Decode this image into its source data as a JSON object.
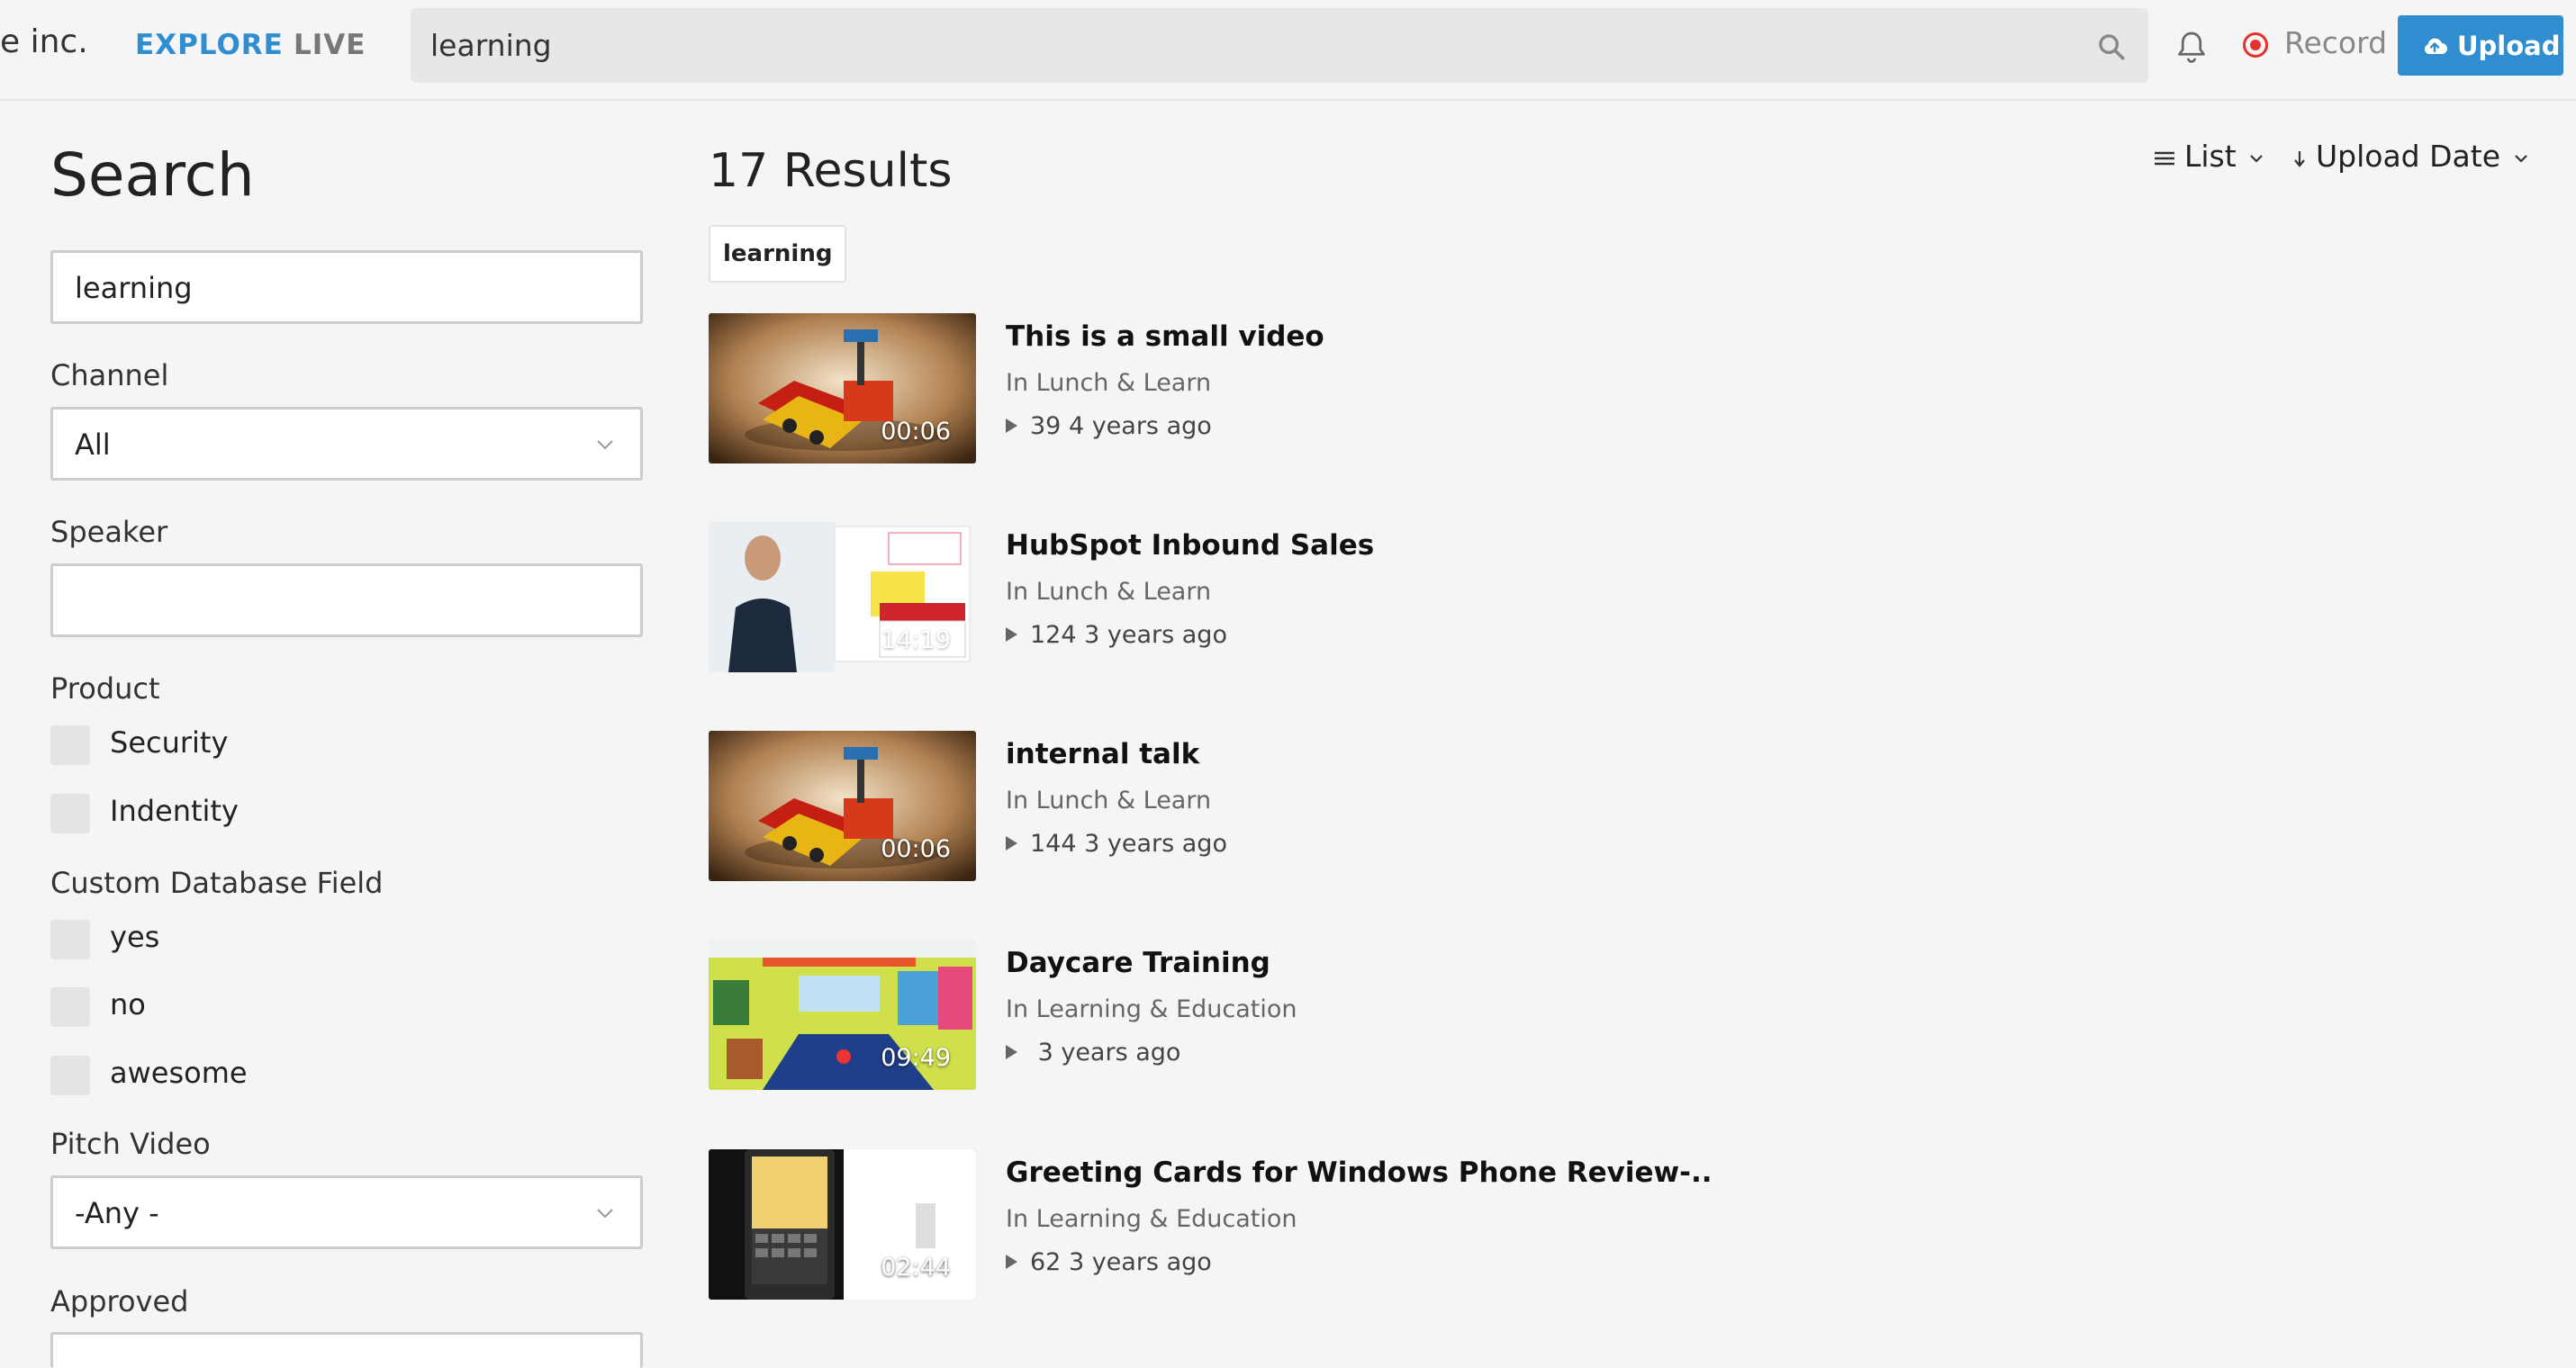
{
  "header": {
    "brand": "e inc.",
    "nav_explore": "EXPLORE",
    "nav_live": "LIVE",
    "search_value": "learning",
    "record_label": "Record",
    "upload_label": "Upload",
    "accent_color": "#2f8dd0"
  },
  "sidebar": {
    "title": "Search",
    "search_value": "learning",
    "channel_label": "Channel",
    "channel_value": "All",
    "speaker_label": "Speaker",
    "speaker_value": "",
    "product_label": "Product",
    "product_options": [
      "Security",
      "Indentity"
    ],
    "custom_field_label": "Custom Database Field",
    "custom_field_options": [
      "yes",
      "no",
      "awesome"
    ],
    "pitch_label": "Pitch Video",
    "pitch_value": "-Any -",
    "approved_label": "Approved"
  },
  "results": {
    "count_label": "17 Results",
    "view_label": "List",
    "sort_label": "Upload Date",
    "filter_chip": "learning",
    "items": [
      {
        "title": "This is a small video",
        "channel": "In Lunch & Learn",
        "meta": "39 4 years ago",
        "duration": "00:06",
        "thumb": "robot-icon"
      },
      {
        "title": "HubSpot Inbound Sales",
        "channel": "In Lunch & Learn",
        "meta": "124 3 years ago",
        "duration": "14:19",
        "thumb": "presenter-icon"
      },
      {
        "title": "internal talk",
        "channel": "In Lunch & Learn",
        "meta": "144 3 years ago",
        "duration": "00:06",
        "thumb": "robot-icon"
      },
      {
        "title": "Daycare Training",
        "channel": "In Learning & Education",
        "meta": " 3 years ago",
        "duration": "09:49",
        "thumb": "classroom-icon"
      },
      {
        "title": "Greeting Cards for Windows Phone Review-..",
        "channel": "In Learning & Education",
        "meta": "62 3 years ago",
        "duration": "02:44",
        "thumb": "phone-icon"
      }
    ]
  }
}
